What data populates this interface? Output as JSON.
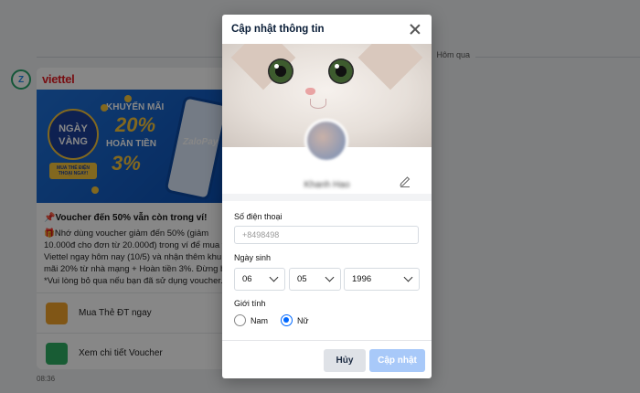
{
  "chat": {
    "date_chip": "Hôm qua",
    "banner": {
      "brand": "viettel",
      "badge_line1": "NGÀY",
      "badge_line2": "VÀNG",
      "badge_sub": "MUA THẺ ĐIỆN THOẠI NGAY!",
      "promo1_label": "KHUYẾN MÃI",
      "promo1_value": "20%",
      "promo2_label": "HOÀN TIỀN",
      "promo2_value": "3%",
      "pay_brand": "ZaloPay"
    },
    "message_title": "📌Voucher đến 50% vẫn còn trong ví!",
    "message_lines": [
      "🎁Nhớ dùng voucher giảm đến 50% (giảm",
      "10.000đ cho đơn từ 20.000đ) trong ví để mua t",
      "Viettel ngay hôm nay (10/5) và nhận thêm khu",
      "mãi 20% từ nhà mạng + Hoàn tiền 3%. Đừng b",
      "*Vui lòng bỏ qua nếu bạn đã sử dụng voucher."
    ],
    "action1_label": "Mua Thẻ ĐT ngay",
    "action2_label": "Xem chi tiết Voucher",
    "time": "08:36"
  },
  "modal": {
    "title": "Cập nhật thông tin",
    "display_name": "Khanh Hao",
    "phone_label": "Số điện thoại",
    "phone_value": "+8498498",
    "dob_label": "Ngày sinh",
    "day": "06",
    "month": "05",
    "year": "1996",
    "gender_label": "Giới tính",
    "gender_male": "Nam",
    "gender_female": "Nữ",
    "gender_selected": "Nữ",
    "cancel_label": "Hủy",
    "update_label": "Cập nhật"
  },
  "colors": {
    "accent": "#0068ff",
    "update_button_disabled": "#a8c9f9",
    "viettel_red": "#e31e24"
  }
}
